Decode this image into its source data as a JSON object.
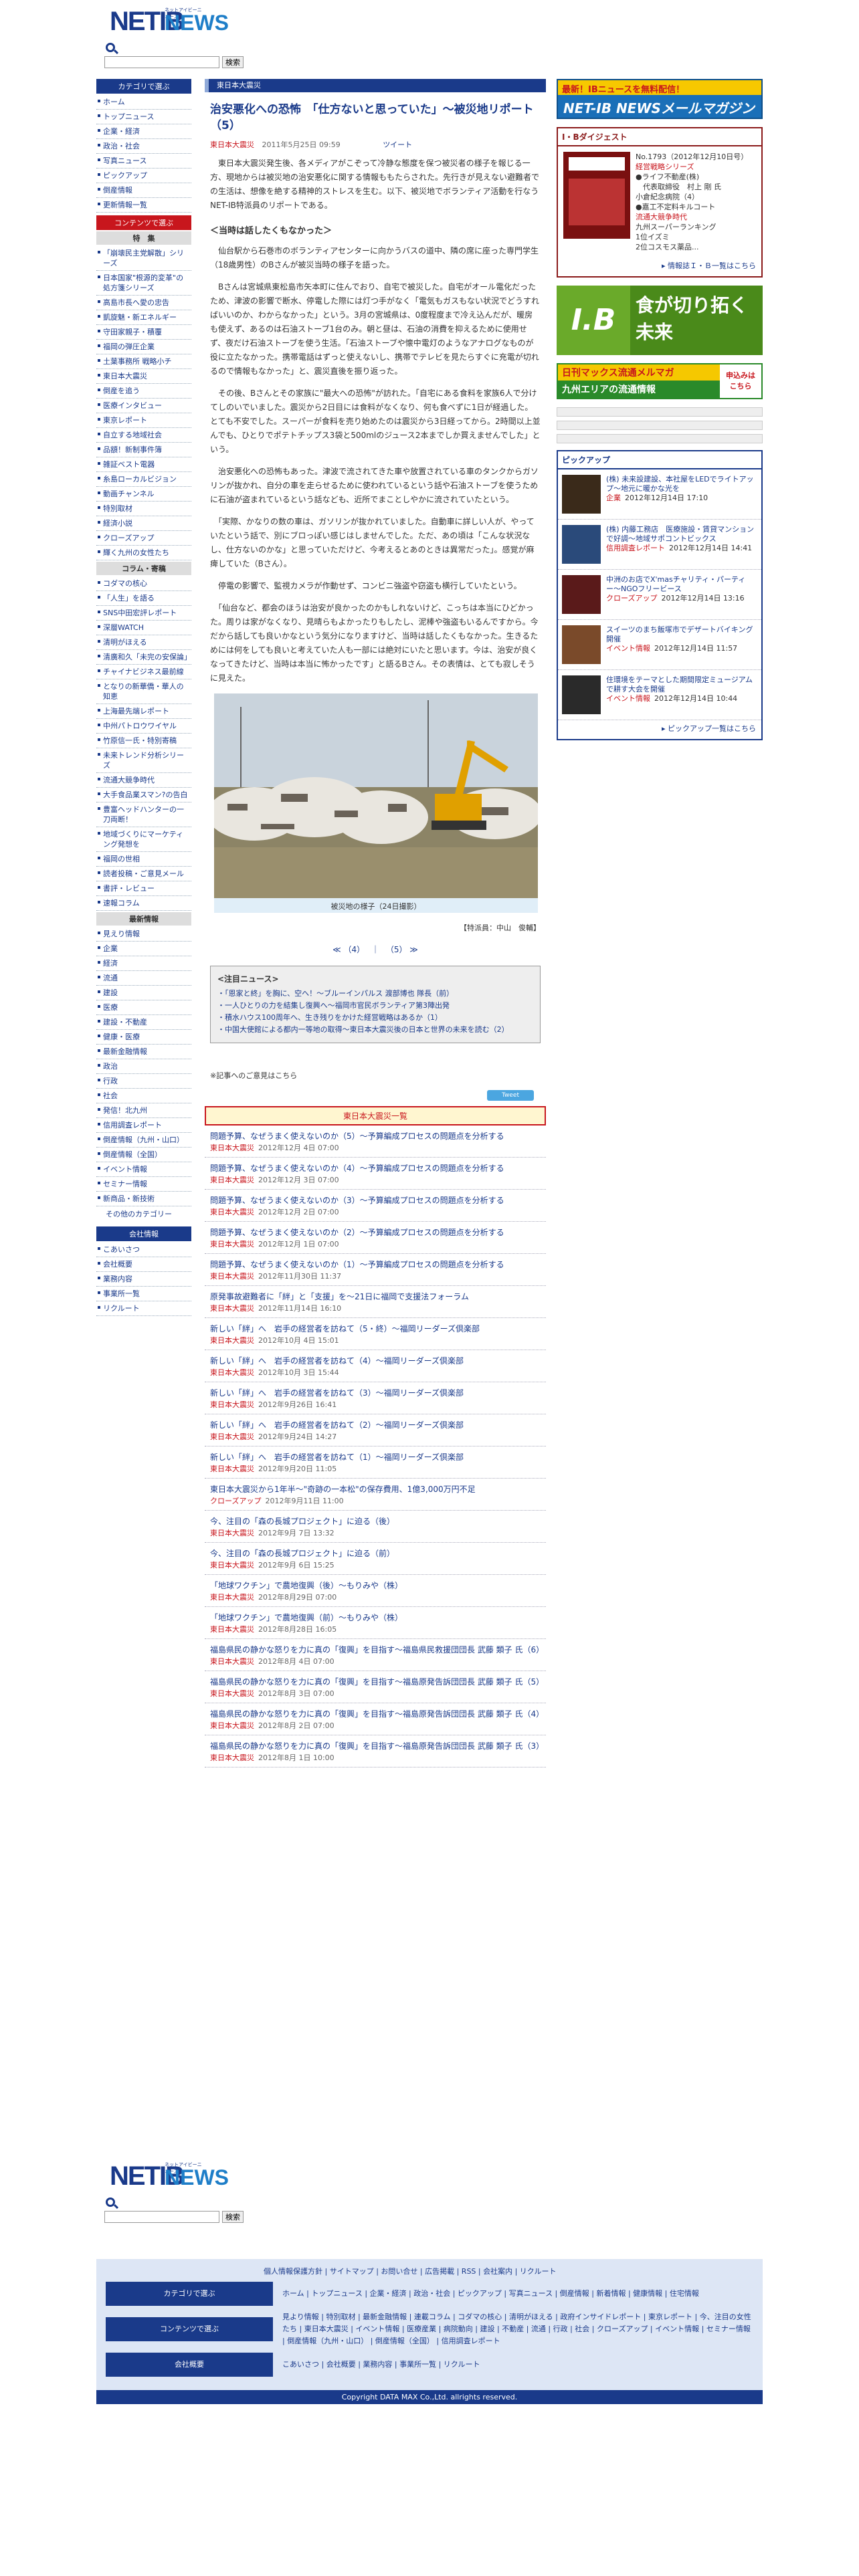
{
  "site": {
    "logo_net": "NETIB",
    "logo_news": "NEWS",
    "logo_sub": "ネットアイビーニュース",
    "search_btn": "検索"
  },
  "left_nav": {
    "cat_head": "カテゴリで選ぶ",
    "cats": [
      "ホーム",
      "トップニュース",
      "企業・経済",
      "政治・社会",
      "写真ニュース",
      "ピックアップ",
      "倒産情報",
      "更新情報一覧"
    ],
    "content_head": "コンテンツで選ぶ",
    "special_head": "特　集",
    "specials": [
      "「崩壊民主党解散」シリーズ",
      "日本国家\"根源的変革\"の処方箋シリーズ",
      "高島市長へ愛の忠告",
      "凱旋魅・新エネルギー",
      "守田家親子・積覆",
      "福岡の弾圧企業",
      "土葉事務所 戦略小チ",
      "東日本大震災",
      "倒産を追う",
      "医療インタビュー",
      "東京レポート",
      "自立する地域社会",
      "品額！新制事件簿",
      "雑証ベスト電器",
      "糸島ローカルビジョン",
      "動画チャンネル",
      "特別取材",
      "経済小説",
      "クローズアップ",
      "輝く九州の女性たち"
    ],
    "column_head": "コラム・寄稿",
    "columns": [
      "コダマの核心",
      "「人生」を語る",
      "SNS中田宏評レポート",
      "深層WATCH",
      "清明がほえる",
      "清廣和久「未完の安保論」",
      "チャイナビジネス最前線",
      "となりの新華僑・華人の知恵",
      "上海最先端レポート",
      "中州パトロウワイヤル",
      "竹原信一氏・特別寄稿",
      "未来トレンド分析シリーズ",
      "流通大競争時代",
      "大手食品業スマン?の告白",
      "豊富ヘッドハンターの一刀両断！",
      "地域づくりにマーケティング発想を",
      "福岡の世相",
      "読者投稿・ご意見メール"
    ],
    "general": [
      "書評・レビュー",
      "速報コラム"
    ],
    "latest_head": "最新情報",
    "latest": [
      "見えり情報",
      "企業",
      "経済",
      "流通",
      "建設",
      "医療",
      "建設・不動産",
      "健康・医療",
      "最新金融情報",
      "政治",
      "行政",
      "社会",
      "発信！北九州",
      "信用調査レポート",
      "倒産情報（九州・山口）",
      "倒産情報（全国）",
      "イベント情報",
      "セミナー情報",
      "新商品・新技術"
    ],
    "other_cat": "その他のカテゴリー",
    "company_head": "会社情報",
    "company": [
      "こあいさつ",
      "会社概要",
      "業務内容",
      "事業所一覧",
      "リクルート"
    ]
  },
  "article": {
    "cat_bar": "東日本大震災",
    "title": "治安悪化への恐怖　「仕方ないと思っていた」〜被災地リポート（5）",
    "category": "東日本大震災",
    "date": "2011年5月25日 09:59",
    "tweet": "ツイート",
    "p1": "　東日本大震災発生後、各メディアがこぞって冷静な態度を保つ被災者の様子を報じる一方、現地からは被災地の治安悪化に関する情報ももたらされた。先行きが見えない避難者での生活は、想像を絶する精神的ストレスを生む。以下、被災地でボランティア活動を行なうNET-IB特派員のリポートである。",
    "h1": "＜当時は話したくもなかった＞",
    "p2": "　仙台駅から石巻市のボランティアセンターに向かうバスの道中、隣の席に座った専門学生（18歳男性）のBさんが被災当時の様子を語った。",
    "p3": "　Bさんは宮城県東松島市矢本町に住んでおり、自宅で被災した。自宅がオール電化だったため、津波の影響で断水、停電した際には灯つ手がなく「電気もガスもない状況でどうすればいいのか、わからなかった」という。3月の宮城県は、0度程度まで冷え込んだが、暖房も使えず、あるのは石油ストーブ1台のみ。朝と昼は、石油の消費を抑えるために使用せず、夜だけ石油ストーブを使う生活。「石油ストーブや懐中電灯のようなアナログなものが役に立たなかった。携帯電話はずっと使えないし、携帯でテレビを見たらすぐに充電が切れるので情報もなかった」と、震災直後を振り返った。",
    "p4": "　その後、Bさんとその家族に\"最大への恐怖\"が訪れた。「自宅にある食料を家族6人で分けてしのいでいました。震災から2日目には食料がなくなり、何も食べずに1日が経過した。とても不安でした。スーパーが食料を売り始めたのは震災から3日経ってから。2時間以上並んでも、ひとりでポテトチップス3袋と500mlのジュース2本までしか買えませんでした」という。",
    "p5": "　治安悪化への恐怖もあった。津波で流されてきた車や放置されている車のタンクからガソリンが抜かれ、自分の車を走らせるために使われているという話や石油ストーブを使うために石油が盗まれているという話なども、近所でまことしやかに流されていたという。",
    "p6": "　「実際、かなりの数の車は、ガソリンが抜かれていました。自動車に詳しい人が、やっていたという話で、別にブロっぽい感じはしませんでした。ただ、あの頃は「こんな状況なし、仕方ないのかな」と思っていただけど、今考えるとあのときは異常だった」。感覚が麻痺していた（Bさん）。",
    "p7": "　停電の影響で、監視カメラが作動せず、コンビニ強盗や窃盗も横行していたという。",
    "p8": "　「仙台など、都会のほうは治安が良かったのかもしれないけど、こっちは本当にひどかった。周りは家がなくなり、見晴らもよかったりもしたし、泥棒や強盗もいるんですから。今だから話しても良いかなという気分になりますけど、当時は話したくもなかった。生きるためには何をしても良いと考えていた人も一部には絶対にいたと思います。今は、治安が良くなってきたけど、当時は本当に怖かったです」と語るBさん。その表情は、とても寂しそうに見えた。",
    "photo_cap": "被災地の様子（24日撮影）",
    "reporter": "【特派員：中山　俊輔】",
    "pager_prev": "≪",
    "pager_4": "（4）",
    "pager_sep1": "｜",
    "pager_5": "（5）",
    "pager_next": "≫",
    "note_head": "<注目ニュース>",
    "notes": [
      "・「恩家と終」を胸に、空へ！〜ブルーインパルス 渡部博也 隊長（前）",
      "・一人ひとりの力を結集し復興へ〜福岡市官民ボランティア第3陣出発",
      "・積水ハウス100周年へ、生き残りをかけた経営戦略はあるか（1）",
      "・中国大使館による都内一等地の取得〜東日本大震災後の日本と世界の未来を読む（2）"
    ],
    "opinion": "※記事へのご意見はこちら",
    "share": "Tweet"
  },
  "related": {
    "head": "東日本大震災一覧",
    "items": [
      {
        "t": "問題予算、なぜうまく使えないのか（5）〜予算編成プロセスの問題点を分析する",
        "c": "東日本大震災",
        "d": "2012年12月 4日 07:00"
      },
      {
        "t": "問題予算、なぜうまく使えないのか（4）〜予算編成プロセスの問題点を分析する",
        "c": "東日本大震災",
        "d": "2012年12月 3日 07:00"
      },
      {
        "t": "問題予算、なぜうまく使えないのか（3）〜予算編成プロセスの問題点を分析する",
        "c": "東日本大震災",
        "d": "2012年12月 2日 07:00"
      },
      {
        "t": "問題予算、なぜうまく使えないのか（2）〜予算編成プロセスの問題点を分析する",
        "c": "東日本大震災",
        "d": "2012年12月 1日 07:00"
      },
      {
        "t": "問題予算、なぜうまく使えないのか（1）〜予算編成プロセスの問題点を分析する",
        "c": "東日本大震災",
        "d": "2012年11月30日 11:37"
      },
      {
        "t": "原発事故避難者に「絆」と「支援」を〜21日に福岡で支援法フォーラム",
        "c": "東日本大震災",
        "d": "2012年11月14日 16:10"
      },
      {
        "t": "新しい「絆」へ　岩手の経営者を訪ねて（5・終）〜福岡リーダーズ倶楽部",
        "c": "東日本大震災",
        "d": "2012年10月 4日 15:01"
      },
      {
        "t": "新しい「絆」へ　岩手の経営者を訪ねて（4）〜福岡リーダーズ倶楽部",
        "c": "東日本大震災",
        "d": "2012年10月 3日 15:44"
      },
      {
        "t": "新しい「絆」へ　岩手の経営者を訪ねて（3）〜福岡リーダーズ倶楽部",
        "c": "東日本大震災",
        "d": "2012年9月26日 16:41"
      },
      {
        "t": "新しい「絆」へ　岩手の経営者を訪ねて（2）〜福岡リーダーズ倶楽部",
        "c": "東日本大震災",
        "d": "2012年9月24日 14:27"
      },
      {
        "t": "新しい「絆」へ　岩手の経営者を訪ねて（1）〜福岡リーダーズ倶楽部",
        "c": "東日本大震災",
        "d": "2012年9月20日 11:05"
      },
      {
        "t": "東日本大震災から1年半〜\"奇跡の一本松\"の保存費用、1億3,000万円不足",
        "c": "クローズアップ",
        "d": "2012年9月11日 11:00"
      },
      {
        "t": "今、注目の「森の長城プロジェクト」に迫る（後）",
        "c": "東日本大震災",
        "d": "2012年9月 7日 13:32"
      },
      {
        "t": "今、注目の「森の長城プロジェクト」に迫る（前）",
        "c": "東日本大震災",
        "d": "2012年9月 6日 15:25"
      },
      {
        "t": "「地球ワクチン」で農地復興（後）〜もりみや（株）",
        "c": "東日本大震災",
        "d": "2012年8月29日 07:00"
      },
      {
        "t": "「地球ワクチン」で農地復興（前）〜もりみや（株）",
        "c": "東日本大震災",
        "d": "2012年8月28日 16:05"
      },
      {
        "t": "福島県民の静かな怒りを力に真の「復興」を目指す〜福島県民救援団団長 武藤 類子 氏（6）",
        "c": "東日本大震災",
        "d": "2012年8月 4日 07:00"
      },
      {
        "t": "福島県民の静かな怒りを力に真の「復興」を目指す〜福島原発告訴団団長 武藤 類子 氏（5）",
        "c": "東日本大震災",
        "d": "2012年8月 3日 07:00"
      },
      {
        "t": "福島県民の静かな怒りを力に真の「復興」を目指す〜福島原発告訴団団長 武藤 類子 氏（4）",
        "c": "東日本大震災",
        "d": "2012年8月 2日 07:00"
      },
      {
        "t": "福島県民の静かな怒りを力に真の「復興」を目指す〜福島原発告訴団団長 武藤 類子 氏（3）",
        "c": "東日本大震災",
        "d": "2012年8月 1日 10:00"
      }
    ]
  },
  "right": {
    "mag_banner_top": "最新！IBニュースを無料配信！",
    "mag_banner_bottom": "NET-IB NEWSメールマガジン",
    "digest_head": "I・Bダイジェスト",
    "digest_lines": [
      "No.1793（2012年12月10日号）",
      "経営戦略シリーズ",
      "●ライフ不動産(株)",
      "　代表取締役　村上 剛 氏",
      "小倉紀念病院（4）",
      "●嘉工不定料キルコート",
      "流通大競争時代",
      "九州スーパーランキング",
      "1位イズミ",
      "2位コスモス薬品..."
    ],
    "digest_more": "▸ 情報誌Ｉ・Ｂ一覧はこちら",
    "ib_banner_left": "I.B",
    "ib_banner_right": "食が切り拓く未来",
    "ryutsu_top": "日刊マックス流通メルマガ",
    "ryutsu_bottom": "九州エリアの流通情報",
    "ryutsu_side": "申込みはこちら",
    "pickup_head": "ピックアップ",
    "pickups": [
      {
        "t": "(株) 未来設建設、本社屋をLEDでライトアップ〜地元に暖かな光を",
        "c": "企業",
        "d": "2012年12月14日 17:10"
      },
      {
        "t": "(株) 内藤工務店　医療施設・賃貸マンションで好調〜地域サポコントビックス",
        "c": "信用調査レポート",
        "d": "2012年12月14日 14:41"
      },
      {
        "t": "中洲のお店でX'masチャリティ・パーティー〜NGOフリービース",
        "c": "クローズアップ",
        "d": "2012年12月14日 13:16"
      },
      {
        "t": "スイーツのまち飯塚市でデザートバイキング開催",
        "c": "イベント情報",
        "d": "2012年12月14日 11:57"
      },
      {
        "t": "住環境をテーマとした期間限定ミュージアムで耕す大会を開催",
        "c": "イベント情報",
        "d": "2012年12月14日 10:44"
      }
    ],
    "pickup_more": "▸ ピックアップ一覧はこちら"
  },
  "footer": {
    "row1": "個人情報保護方針 | サイトマップ | お問い合せ | 広告掲載 | RSS | 会社案内 | リクルート",
    "cat_label": "カテゴリで選ぶ",
    "cat_links": "ホーム | トップニュース | 企業・経済 | 政治・社会 | ピックアップ | 写真ニュース | 倒産情報 | 新着情報 | 健康情報 | 住宅情報",
    "content_label": "コンテンツで選ぶ",
    "content_links": "見より情報 | 特別取材 | 最新金融情報 | 連載コラム | コダマの核心 | 清明がほえる | 政府インサイドレポート | 東京レポート | 今、注目の女性たち | 東日本大震災 | イベント情報 | 医療産業 | 病院動向 | 建設 | 不動産 | 流通 | 行政 | 社会 | クローズアップ | イベント情報 | セミナー情報 | 倒産情報（九州・山口） | 倒産情報（全国） | 信用調査レポート",
    "company_label": "会社概要",
    "company_links": "こあいさつ | 会社概要 | 業務内容 | 事業所一覧 | リクルート",
    "copyright": "Copyright DATA MAX Co.,Ltd. allrights reserved."
  },
  "colors": {
    "brand": "#1a3a8a",
    "accent": "#c8161d"
  }
}
